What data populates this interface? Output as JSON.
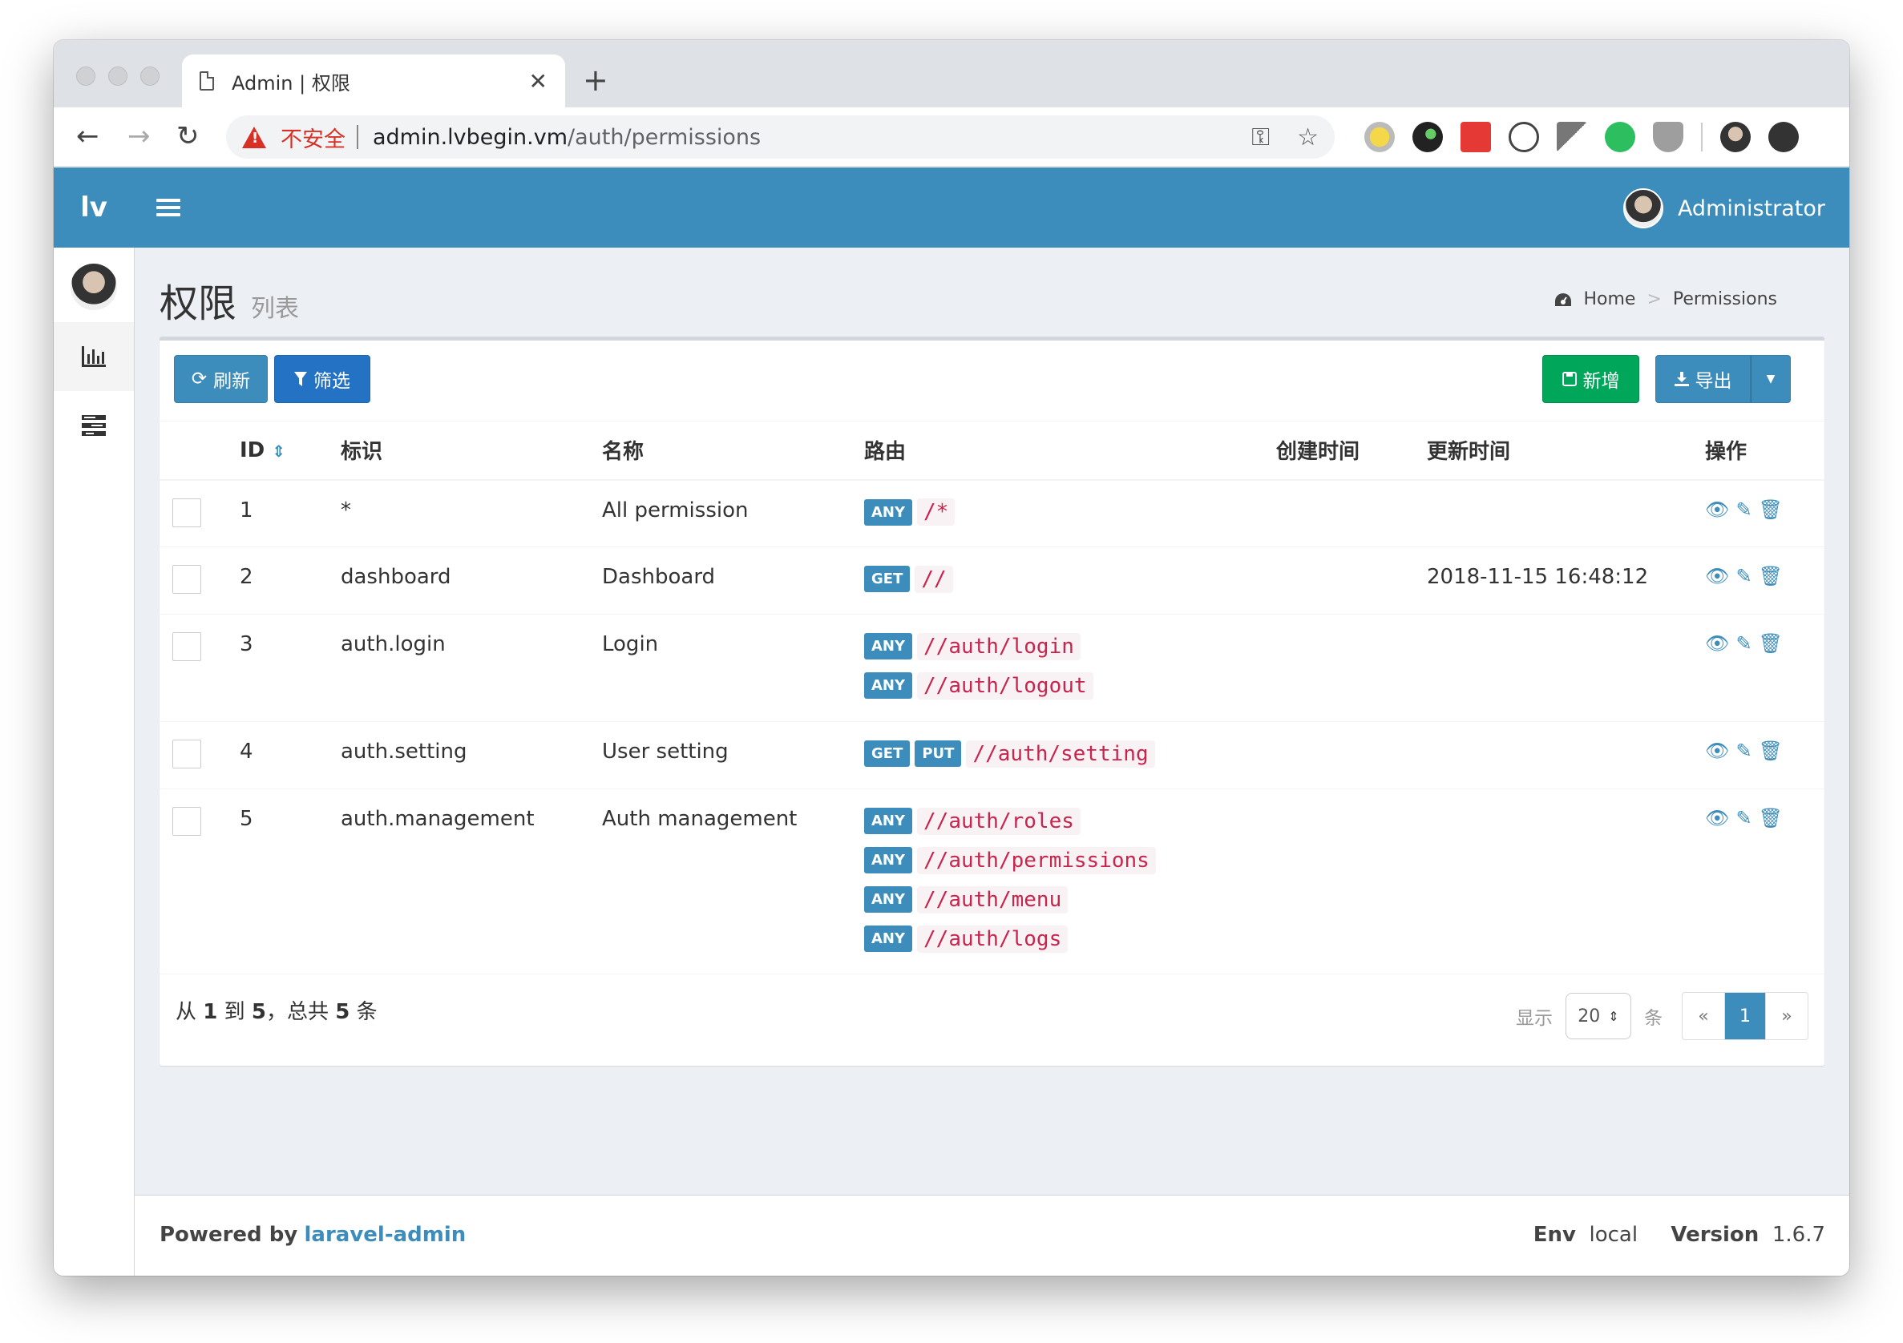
{
  "browser": {
    "tab_title": "Admin | 权限",
    "security_label": "不安全",
    "url_host": "admin.lvbegin.vm",
    "url_path": "/auth/permissions"
  },
  "app": {
    "logo": "lv",
    "user_name": "Administrator"
  },
  "page": {
    "title": "权限",
    "subtitle": "列表",
    "breadcrumb_home": "Home",
    "breadcrumb_current": "Permissions"
  },
  "toolbar": {
    "refresh_label": "刷新",
    "filter_label": "筛选",
    "create_label": "新增",
    "export_label": "导出"
  },
  "table": {
    "columns": [
      "ID",
      "标识",
      "名称",
      "路由",
      "创建时间",
      "更新时间",
      "操作"
    ],
    "rows": [
      {
        "id": "1",
        "slug": "*",
        "name": "All permission",
        "routes": [
          {
            "methods": [
              "ANY"
            ],
            "path": "/*"
          }
        ],
        "created": "",
        "updated": ""
      },
      {
        "id": "2",
        "slug": "dashboard",
        "name": "Dashboard",
        "routes": [
          {
            "methods": [
              "GET"
            ],
            "path": "//"
          }
        ],
        "created": "",
        "updated": "2018-11-15 16:48:12"
      },
      {
        "id": "3",
        "slug": "auth.login",
        "name": "Login",
        "routes": [
          {
            "methods": [
              "ANY"
            ],
            "path": "//auth/login"
          },
          {
            "methods": [
              "ANY"
            ],
            "path": "//auth/logout"
          }
        ],
        "created": "",
        "updated": ""
      },
      {
        "id": "4",
        "slug": "auth.setting",
        "name": "User setting",
        "routes": [
          {
            "methods": [
              "GET",
              "PUT"
            ],
            "path": "//auth/setting"
          }
        ],
        "created": "",
        "updated": ""
      },
      {
        "id": "5",
        "slug": "auth.management",
        "name": "Auth management",
        "routes": [
          {
            "methods": [
              "ANY"
            ],
            "path": "//auth/roles"
          },
          {
            "methods": [
              "ANY"
            ],
            "path": "//auth/permissions"
          },
          {
            "methods": [
              "ANY"
            ],
            "path": "//auth/menu"
          },
          {
            "methods": [
              "ANY"
            ],
            "path": "//auth/logs"
          }
        ],
        "created": "",
        "updated": ""
      }
    ]
  },
  "pagination": {
    "summary_prefix": "从",
    "from": "1",
    "to_word": "到",
    "to": "5",
    "total_prefix": "，总共",
    "total": "5",
    "unit": "条",
    "show_label": "显示",
    "per_page": "20",
    "per_page_unit": "条",
    "prev": "«",
    "current": "1",
    "next": "»"
  },
  "footer": {
    "powered_by": "Powered by",
    "powered_link": "laravel-admin",
    "env_label": "Env",
    "env_value": "local",
    "version_label": "Version",
    "version_value": "1.6.7"
  },
  "colors": {
    "header_bg": "#3c8dbc",
    "success": "#00a65a",
    "code_text": "#c7254e"
  }
}
